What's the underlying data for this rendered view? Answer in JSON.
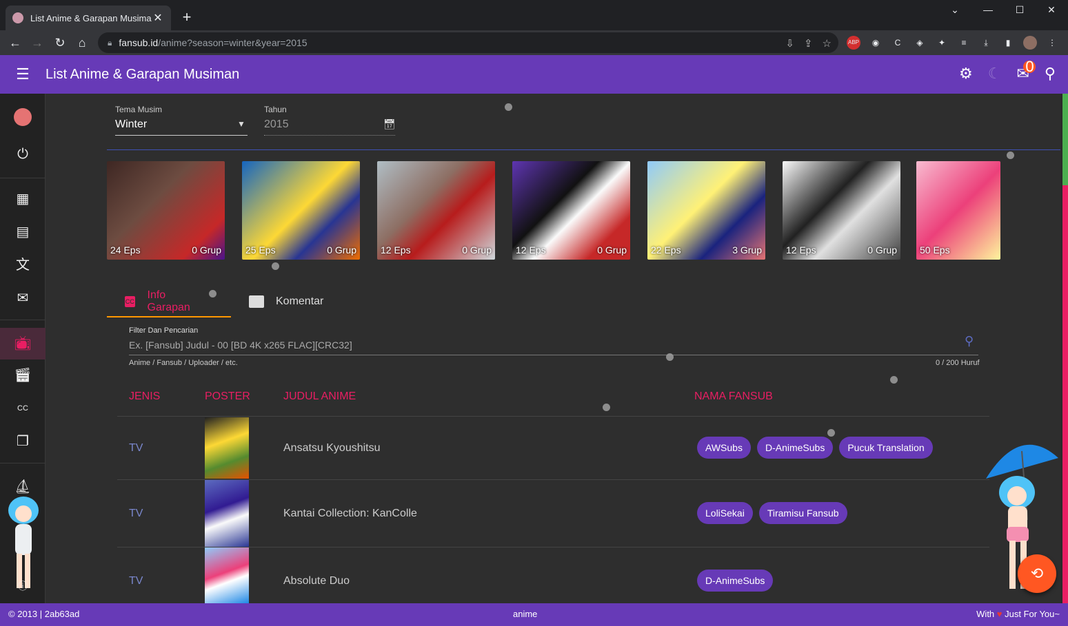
{
  "browser": {
    "tab_title": "List Anime & Garapan Musiman |",
    "tab_close": "✕",
    "new_tab": "+",
    "url_host": "fansub.id",
    "url_path": "/anime?season=winter&year=2015",
    "abp_label": "ABP"
  },
  "app": {
    "title": "List Anime & Garapan Musiman",
    "notification_count": "0",
    "accent": "#673ab7",
    "pink": "#e91e63"
  },
  "filters": {
    "season_label": "Tema Musim",
    "season_value": "Winter",
    "year_label": "Tahun",
    "year_value": "2015"
  },
  "posters": [
    {
      "eps": "24 Eps",
      "grup": "0 Grup"
    },
    {
      "eps": "25 Eps",
      "grup": "0 Grup"
    },
    {
      "eps": "12 Eps",
      "grup": "0 Grup"
    },
    {
      "eps": "12 Eps",
      "grup": "0 Grup"
    },
    {
      "eps": "22 Eps",
      "grup": "3 Grup"
    },
    {
      "eps": "12 Eps",
      "grup": "0 Grup"
    },
    {
      "eps": "50 Eps",
      "grup": ""
    }
  ],
  "tabs": {
    "info": "Info Garapan",
    "komentar": "Komentar"
  },
  "search": {
    "label": "Filter Dan Pencarian",
    "placeholder": "Ex. [Fansub] Judul - 00 [BD 4K x265 FLAC][CRC32]",
    "hint": "Anime / Fansub / Uploader / etc.",
    "counter": "0 / 200 Huruf"
  },
  "table": {
    "headers": {
      "jenis": "JENIS",
      "poster": "POSTER",
      "judul": "JUDUL ANIME",
      "fansub": "NAMA FANSUB"
    },
    "rows": [
      {
        "jenis": "TV",
        "judul": "Ansatsu Kyoushitsu",
        "fansubs": [
          "AWSubs",
          "D-AnimeSubs",
          "Pucuk Translation"
        ]
      },
      {
        "jenis": "TV",
        "judul": "Kantai Collection: KanColle",
        "fansubs": [
          "LoliSekai",
          "Tiramisu Fansub"
        ]
      },
      {
        "jenis": "TV",
        "judul": "Absolute Duo",
        "fansubs": [
          "D-AnimeSubs"
        ]
      }
    ]
  },
  "footer": {
    "left": "2013 | 2ab63ad",
    "center": "anime",
    "right_prefix": "With",
    "right_suffix": "Just For You~"
  }
}
